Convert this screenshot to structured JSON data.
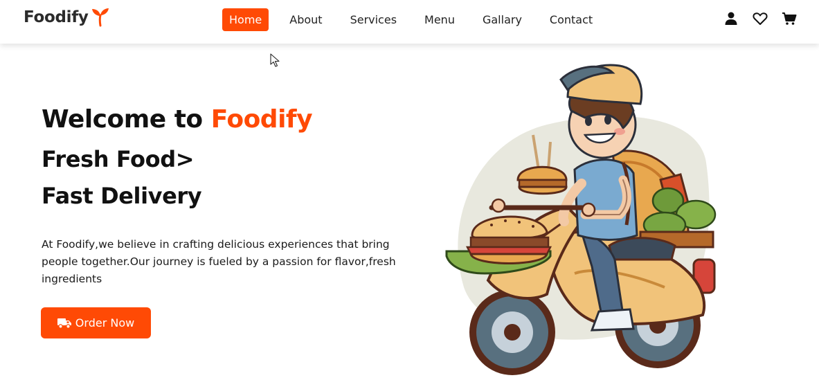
{
  "brand": {
    "name": "Foodify",
    "accent_color": "#ff4a05",
    "logo_icon": "sprout-icon"
  },
  "nav": {
    "items": [
      {
        "label": "Home",
        "active": true
      },
      {
        "label": "About",
        "active": false
      },
      {
        "label": "Services",
        "active": false
      },
      {
        "label": "Menu",
        "active": false
      },
      {
        "label": "Gallary",
        "active": false
      },
      {
        "label": "Contact",
        "active": false
      }
    ],
    "icons": [
      "user-icon",
      "heart-icon",
      "cart-icon"
    ]
  },
  "hero": {
    "title_prefix": "Welcome to",
    "title_brand": "Foodify",
    "line1": "Fresh Food>",
    "line2": "Fast Delivery",
    "description": "At Foodify,we believe in crafting delicious experiences that bring people together.Our journey is fueled by a passion for flavor,fresh ingredients",
    "cta_label": "Order Now",
    "cta_icon": "truck-icon",
    "image": "delivery-scooter-illustration"
  }
}
